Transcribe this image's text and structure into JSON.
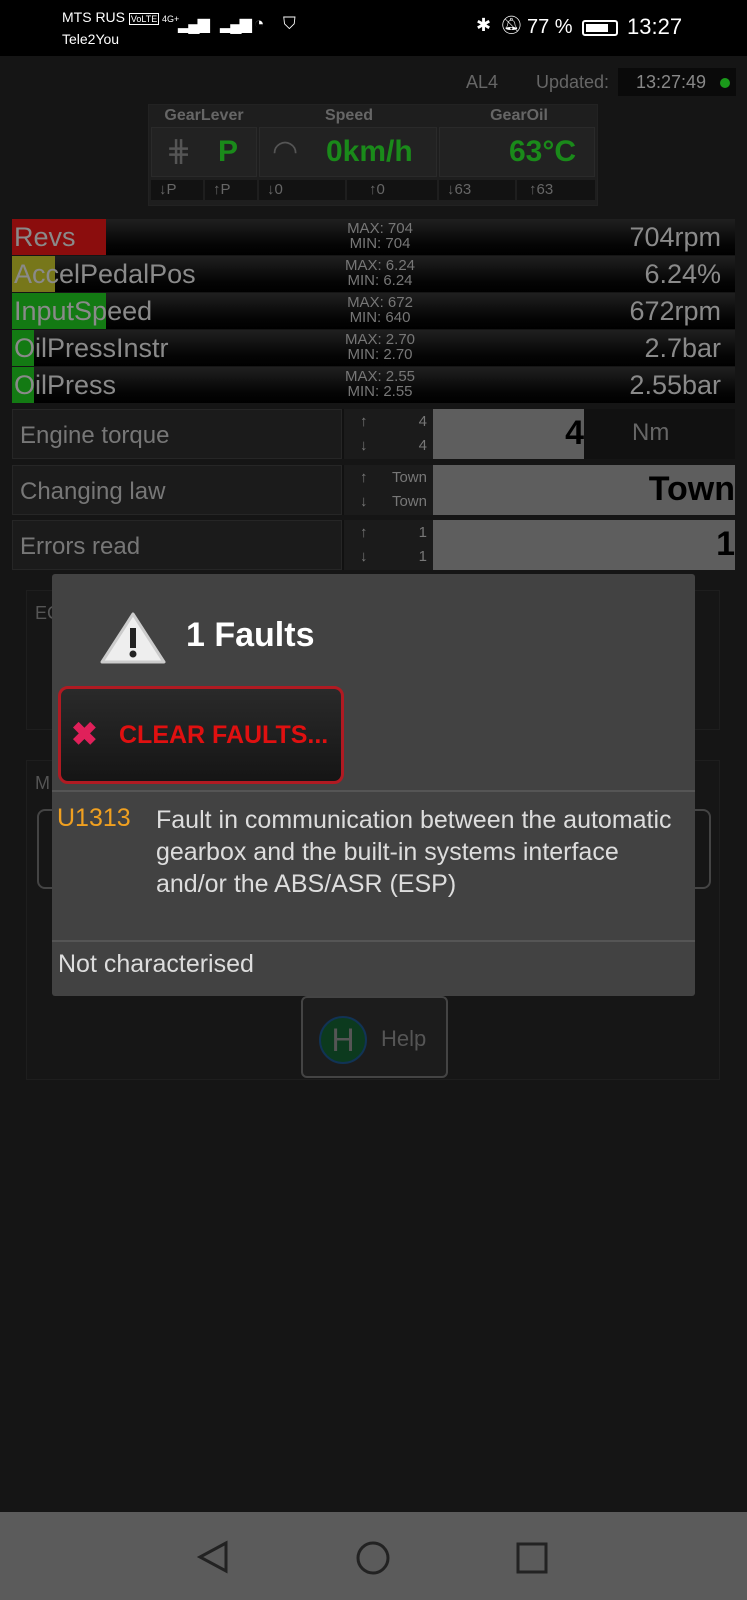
{
  "status_bar": {
    "carrier1": "MTS RUS",
    "volte": "VoLTE",
    "network": "4G+",
    "carrier2": "Tele2You",
    "battery": "77 %",
    "time": "13:27"
  },
  "header": {
    "ecu": "AL4",
    "updated_label": "Updated:",
    "updated_time": "13:27:49",
    "status_color": "#1a9a1a"
  },
  "gauges": [
    {
      "label": "GearLever",
      "value": "P",
      "icon": "gear-shift-icon",
      "min": "↓P",
      "max": "↑P"
    },
    {
      "label": "Speed",
      "value": "0km/h",
      "icon": "speedometer-icon",
      "min": "↓0",
      "max": "↑0"
    },
    {
      "label": "GearOil",
      "value": "63°C",
      "min": "↓63",
      "max": "↑63"
    }
  ],
  "bars": [
    {
      "name": "Revs",
      "max": "MAX: 704",
      "min": "MIN: 704",
      "value": "704rpm",
      "fill_percent": 13,
      "color": "#8b0d0d"
    },
    {
      "name": "AccelPedalPos",
      "max": "MAX: 6.24",
      "min": "MIN: 6.24",
      "value": "6.24%",
      "fill_percent": 6,
      "color": "#77771a"
    },
    {
      "name": "InputSpeed",
      "max": "MAX: 672",
      "min": "MIN: 640",
      "value": "672rpm",
      "fill_percent": 13,
      "color": "#137a13"
    },
    {
      "name": "OilPressInstr",
      "max": "MAX: 2.70",
      "min": "MIN: 2.70",
      "value": "2.7bar",
      "fill_percent": 3,
      "color": "#137a13"
    },
    {
      "name": "OilPress",
      "max": "MAX: 2.55",
      "min": "MIN: 2.55",
      "value": "2.55bar",
      "fill_percent": 3,
      "color": "#137a13"
    }
  ],
  "params": [
    {
      "label": "Engine torque",
      "up": "4",
      "down": "4",
      "value": "4",
      "unit": "Nm"
    },
    {
      "label": "Changing law",
      "up": "Town",
      "down": "Town",
      "value": "Town"
    },
    {
      "label": "Errors read",
      "up": "1",
      "down": "1",
      "value": "1"
    }
  ],
  "background": {
    "panel1_label": "EC",
    "panel2_label": "M",
    "help_label": "Help",
    "help_icon": "H"
  },
  "dialog": {
    "title": "1 Faults",
    "clear_label": "CLEAR FAULTS...",
    "fault_code": "U1313",
    "fault_text": "Fault in communication between the automatic gearbox and the built-in systems interface and/or the ABS/ASR (ESP)",
    "fault_status": "Not characterised",
    "code_color": "#f0a020",
    "clear_color": "#e01010"
  }
}
